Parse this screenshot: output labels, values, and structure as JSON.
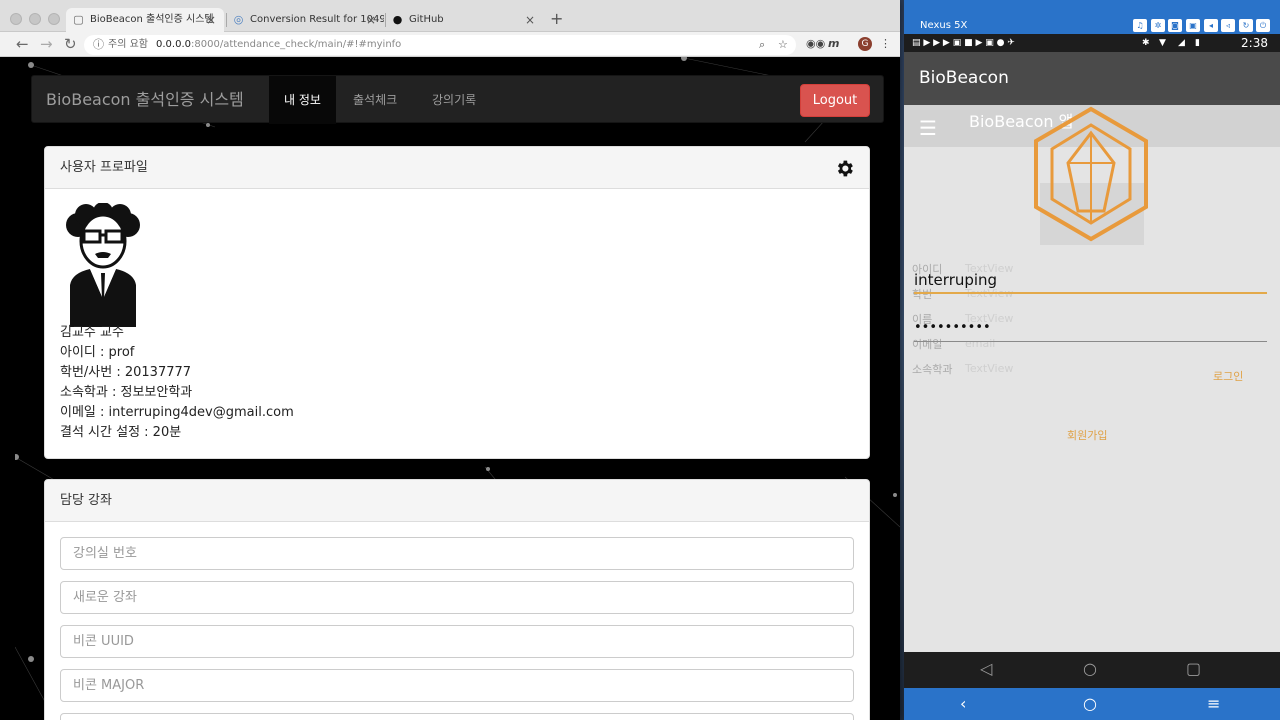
{
  "browser": {
    "tabs": [
      {
        "title": "BioBeacon 출석인증 시스템",
        "active": true
      },
      {
        "title": "Conversion Result for 1049b4",
        "active": false
      },
      {
        "title": "GitHub",
        "active": false
      }
    ],
    "new_tab": "+",
    "security_warning": "주의 요함",
    "url_host": "0.0.0.0",
    "url_rest": ":8000/attendance_check/main/#!#myinfo",
    "profile_initial": "G"
  },
  "navbar": {
    "brand": "BioBeacon 출석인증 시스템",
    "links": [
      "내 정보",
      "출석체크",
      "강의기록"
    ],
    "logout": "Logout"
  },
  "profile": {
    "heading": "사용자 프로파일",
    "lines": [
      "김교수 교수",
      "아이디 : prof",
      "학번/사번 : 20137777",
      "소속학과 : 정보보안학과",
      "이메일 : interruping4dev@gmail.com",
      "결석 시간 설정 : 20분"
    ]
  },
  "courses": {
    "heading": "담당 강좌",
    "placeholders": [
      "강의실 번호",
      "새로운 강좌",
      "비콘 UUID",
      "비콘 MAJOR"
    ]
  },
  "emulator": {
    "device": "Nexus 5X",
    "clock": "2:38",
    "app_title": "BioBeacon",
    "sub_title": "BioBeacon 앱",
    "field_labels": [
      "아이디",
      "학번",
      "이름",
      "이메일",
      "소속학과"
    ],
    "field_values": [
      "TextView",
      "TextView",
      "TextView",
      "email",
      "TextView"
    ],
    "id_value": "interruping",
    "pw_value": "••••••••••",
    "login": "로그인",
    "signup": "회원가입"
  },
  "colors": {
    "logout_bg": "#d9534f",
    "emulator_frame": "#2a73c9",
    "accent_orange": "#e0a247"
  }
}
